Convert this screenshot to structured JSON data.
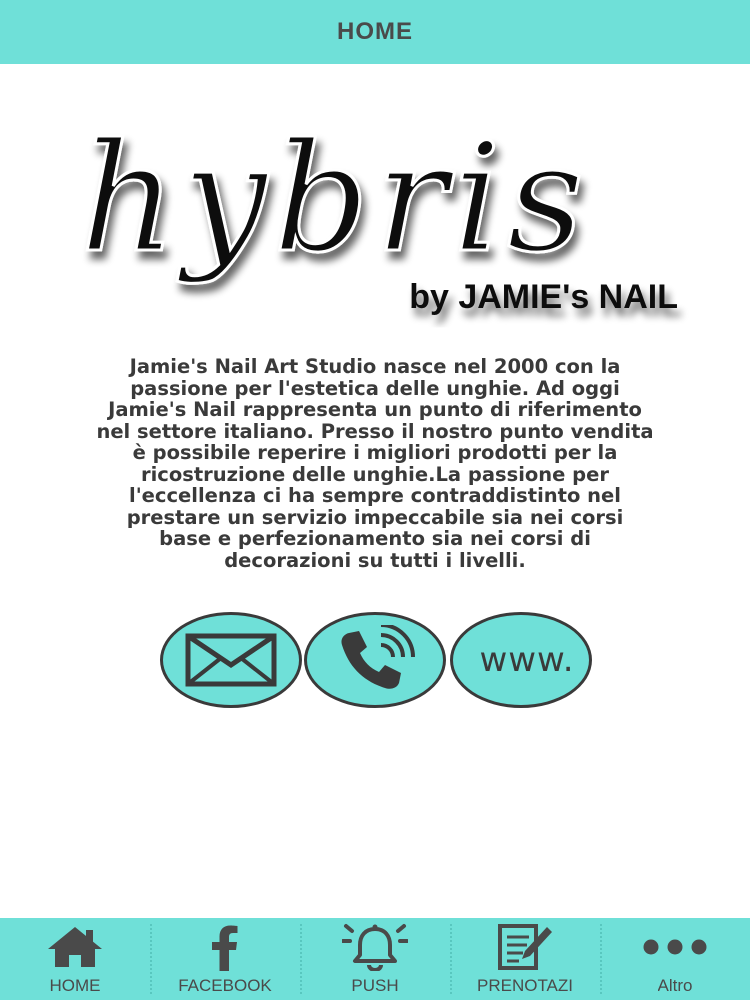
{
  "header": {
    "title": "HOME"
  },
  "logo": {
    "wordmark": "hybris",
    "tagline": "by JAMIE's NAIL"
  },
  "intro": {
    "lines": [
      "Jamie's Nail Art Studio nasce nel 2000 con la",
      "passione per l'estetica delle unghie. Ad oggi",
      "Jamie's Nail rappresenta un punto di riferimento",
      "nel settore italiano. Presso il nostro punto vendita",
      "è possibile reperire i migliori prodotti per la",
      "ricostruzione delle unghie.La passione per",
      "l'eccellenza ci ha sempre contraddistinto nel",
      "prestare un servizio impeccabile sia nei corsi",
      "base e perfezionamento sia nei corsi di",
      "decorazioni su tutti i livelli."
    ]
  },
  "contact": {
    "email_icon": "envelope-icon",
    "phone_icon": "phone-icon",
    "web_label": "www."
  },
  "bottom_nav": [
    {
      "label": "HOME",
      "icon": "home-icon"
    },
    {
      "label": "FACEBOOK",
      "icon": "facebook-icon"
    },
    {
      "label": "PUSH",
      "icon": "bell-icon"
    },
    {
      "label": "PRENOTAZI",
      "icon": "booking-icon"
    },
    {
      "label": "Altro",
      "icon": "more-icon"
    }
  ],
  "colors": {
    "accent": "#6fe0d8",
    "text": "#3a3a3a"
  }
}
